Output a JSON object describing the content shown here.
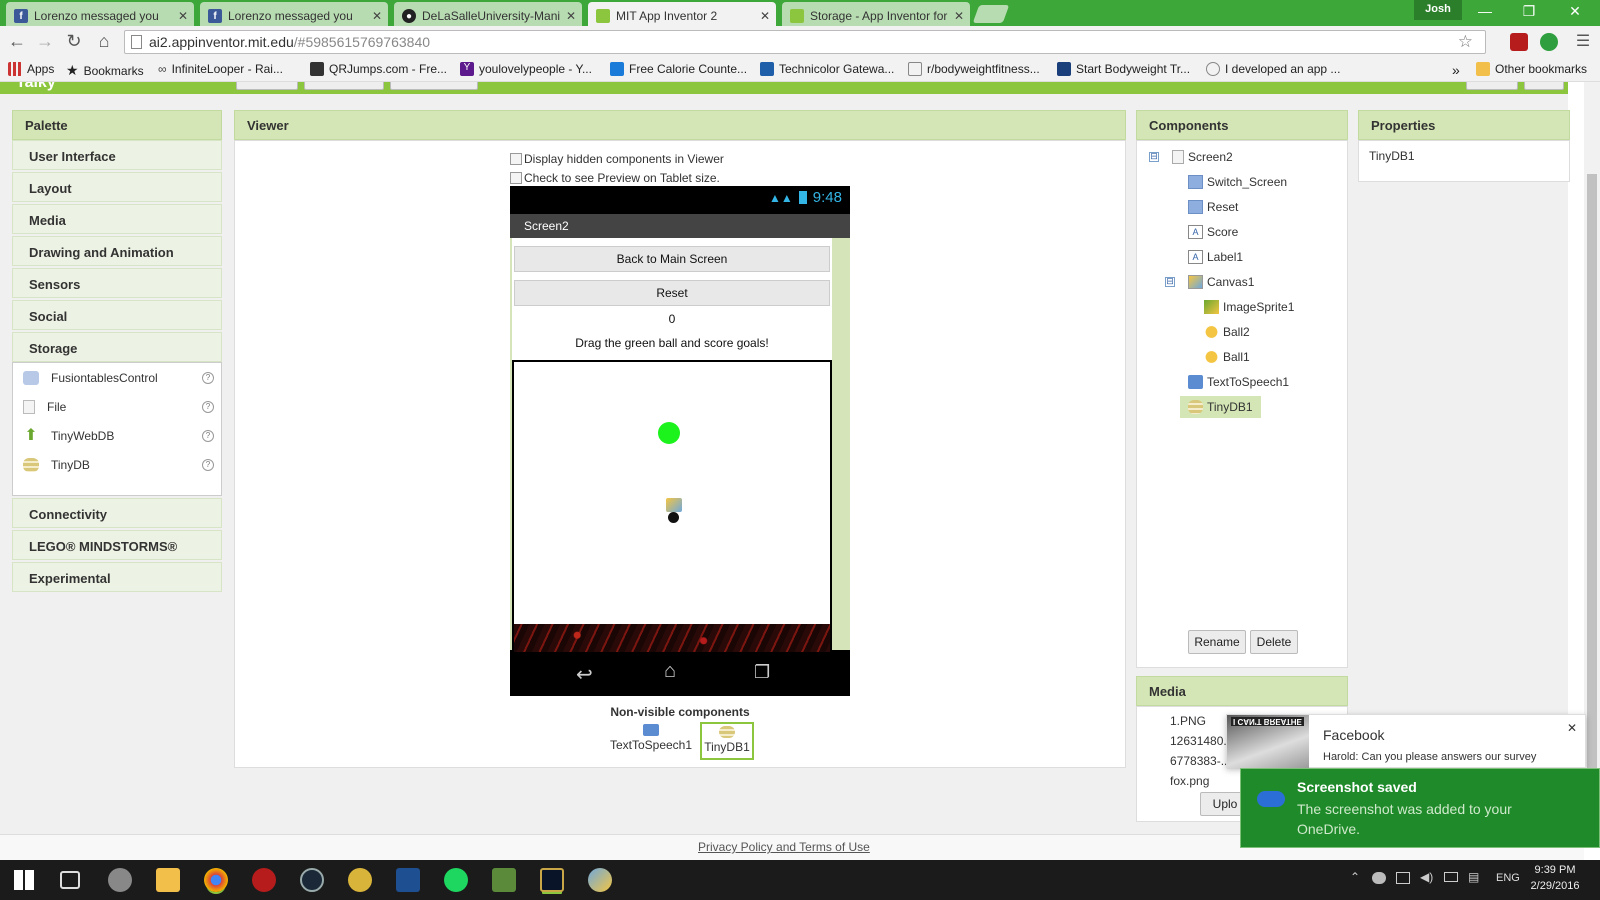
{
  "browser": {
    "tabs": [
      {
        "title": "Lorenzo messaged you",
        "icon": "facebook-icon"
      },
      {
        "title": "Lorenzo messaged you",
        "icon": "facebook-icon"
      },
      {
        "title": "DeLaSalleUniversity-Manil",
        "icon": "github-icon"
      },
      {
        "title": "MIT App Inventor 2",
        "icon": "appinventor-icon",
        "active": true
      },
      {
        "title": "Storage - App Inventor for",
        "icon": "appinventor-icon"
      }
    ],
    "profile": "Josh",
    "url_host": "ai2.appinventor.mit.edu",
    "url_path": "/#5985615769763840",
    "bookmarks": [
      "Apps",
      "Bookmarks",
      "InfiniteLooper - Rai...",
      "QRJumps.com - Fre...",
      "youlovelypeople - Y...",
      "Free Calorie Counte...",
      "Technicolor Gatewa...",
      "r/bodyweightfitness...",
      "Start Bodyweight Tr...",
      "I developed an app ..."
    ],
    "more_bookmarks": "»",
    "other_bookmarks": "Other bookmarks"
  },
  "app": {
    "project_title": "Taiky"
  },
  "palette": {
    "title": "Palette",
    "categories_top": [
      "User Interface",
      "Layout",
      "Media",
      "Drawing and Animation",
      "Sensors",
      "Social",
      "Storage"
    ],
    "storage_items": [
      {
        "label": "FusiontablesControl",
        "icon": "fusiontables-icon"
      },
      {
        "label": "File",
        "icon": "file-icon"
      },
      {
        "label": "TinyWebDB",
        "icon": "tinywebdb-icon"
      },
      {
        "label": "TinyDB",
        "icon": "tinydb-icon"
      }
    ],
    "help_glyph": "?",
    "categories_bottom": [
      "Connectivity",
      "LEGO® MINDSTORMS®",
      "Experimental"
    ]
  },
  "viewer": {
    "title": "Viewer",
    "checkbox_hidden": "Display hidden components in Viewer",
    "checkbox_tablet": "Check to see Preview on Tablet size.",
    "phone": {
      "time": "9:48",
      "screen_title": "Screen2",
      "back_button": "Back to Main Screen",
      "reset_button": "Reset",
      "score": "0",
      "instructions": "Drag the green ball and score goals!"
    },
    "nonvisible_title": "Non-visible components",
    "nonvisible": [
      "TextToSpeech1",
      "TinyDB1"
    ]
  },
  "components": {
    "title": "Components",
    "tree": [
      {
        "label": "Screen2",
        "icon": "screen-icon"
      },
      {
        "label": "Switch_Screen",
        "icon": "button-icon"
      },
      {
        "label": "Reset",
        "icon": "button-icon"
      },
      {
        "label": "Score",
        "icon": "label-icon"
      },
      {
        "label": "Label1",
        "icon": "label-icon"
      },
      {
        "label": "Canvas1",
        "icon": "canvas-icon"
      },
      {
        "label": "ImageSprite1",
        "icon": "imagesprite-icon"
      },
      {
        "label": "Ball2",
        "icon": "ball-icon"
      },
      {
        "label": "Ball1",
        "icon": "ball-icon"
      },
      {
        "label": "TextToSpeech1",
        "icon": "texttospeech-icon"
      },
      {
        "label": "TinyDB1",
        "icon": "tinydb-icon",
        "selected": true
      }
    ],
    "collapse_glyph": "⊟",
    "rename_button": "Rename",
    "delete_button": "Delete"
  },
  "media": {
    "title": "Media",
    "files": [
      "1.PNG",
      "12631480...",
      "6778383-...",
      "fox.png"
    ],
    "upload_button": "Uplo"
  },
  "properties": {
    "title": "Properties",
    "selected": "TinyDB1"
  },
  "footer": {
    "privacy": "Privacy Policy and Terms of Use"
  },
  "notifications": {
    "facebook_title": "Facebook",
    "facebook_body": "Harold: Can you please answers our survey",
    "facebook_image_caption": "I CAN'T BREATHE",
    "onedrive_title": "Screenshot saved",
    "onedrive_body": "The screenshot was added to your OneDrive."
  },
  "taskbar": {
    "time": "9:39 PM",
    "date": "2/29/2016",
    "lang": "ENG"
  },
  "colors": {
    "tabbar": "#3da73a",
    "app_header": "#8cc63f",
    "panel_header": "#d4e6b5",
    "onedrive_toast": "#1e8a2a",
    "ball_green": "#1cf21c"
  }
}
